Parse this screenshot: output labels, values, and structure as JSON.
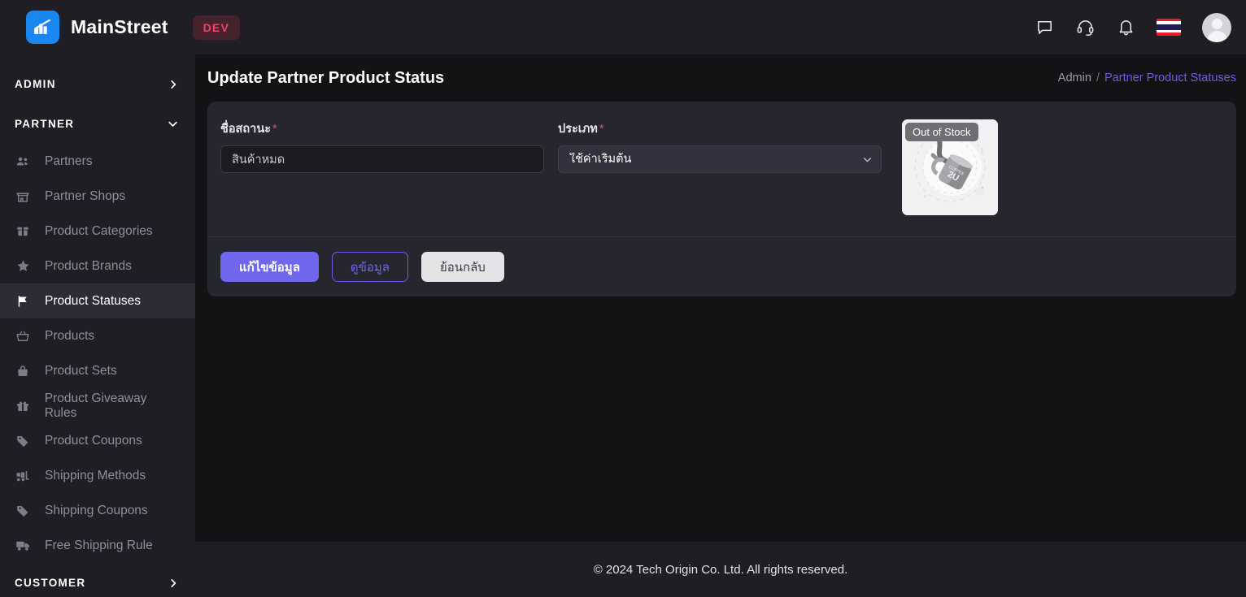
{
  "topbar": {
    "brand_name": "MainStreet",
    "env_badge": "DEV",
    "icons": [
      "chat-icon",
      "headset-icon",
      "bell-icon",
      "thai-flag-icon",
      "avatar"
    ]
  },
  "sidebar": {
    "sections": [
      {
        "label": "ADMIN",
        "expanded": false
      },
      {
        "label": "PARTNER",
        "expanded": true
      },
      {
        "label": "CUSTOMER",
        "expanded": false
      }
    ],
    "items": [
      {
        "label": "Partners",
        "icon": "users-icon",
        "active": false
      },
      {
        "label": "Partner Shops",
        "icon": "store-icon",
        "active": false
      },
      {
        "label": "Product Categories",
        "icon": "box-icon",
        "active": false
      },
      {
        "label": "Product Brands",
        "icon": "star-icon",
        "active": false
      },
      {
        "label": "Product Statuses",
        "icon": "flag-icon",
        "active": true
      },
      {
        "label": "Products",
        "icon": "basket-icon",
        "active": false
      },
      {
        "label": "Product Sets",
        "icon": "bag-icon",
        "active": false
      },
      {
        "label": "Product Giveaway Rules",
        "icon": "gift-icon",
        "active": false
      },
      {
        "label": "Product Coupons",
        "icon": "tag-icon",
        "active": false
      },
      {
        "label": "Shipping Methods",
        "icon": "forklift-icon",
        "active": false
      },
      {
        "label": "Shipping Coupons",
        "icon": "tag-icon",
        "active": false
      },
      {
        "label": "Free Shipping Rule",
        "icon": "truck-icon",
        "active": false
      }
    ]
  },
  "page": {
    "title": "Update Partner Product Status",
    "breadcrumb_root": "Admin",
    "breadcrumb_sep": "/",
    "breadcrumb_current": "Partner Product Statuses"
  },
  "form": {
    "name_label": "ชื่อสถานะ",
    "name_required": "*",
    "name_value": "สินค้าหมด",
    "type_label": "ประเภท",
    "type_required": "*",
    "type_value": "ใช้ค่าเริ่มต้น",
    "image_tooltip": "Out of Stock"
  },
  "actions": {
    "edit": "แก้ไขข้อมูล",
    "view": "ดูข้อมูล",
    "back": "ย้อนกลับ"
  },
  "footer": {
    "copyright": "© 2024 Tech Origin Co. Ltd. All rights reserved."
  },
  "colors": {
    "accent": "#7166ee",
    "brand_blue": "#1a86ef",
    "danger": "#f1416c",
    "topbar_bg": "#1e1e24",
    "page_bg": "#131316",
    "card_bg": "#26262e"
  }
}
